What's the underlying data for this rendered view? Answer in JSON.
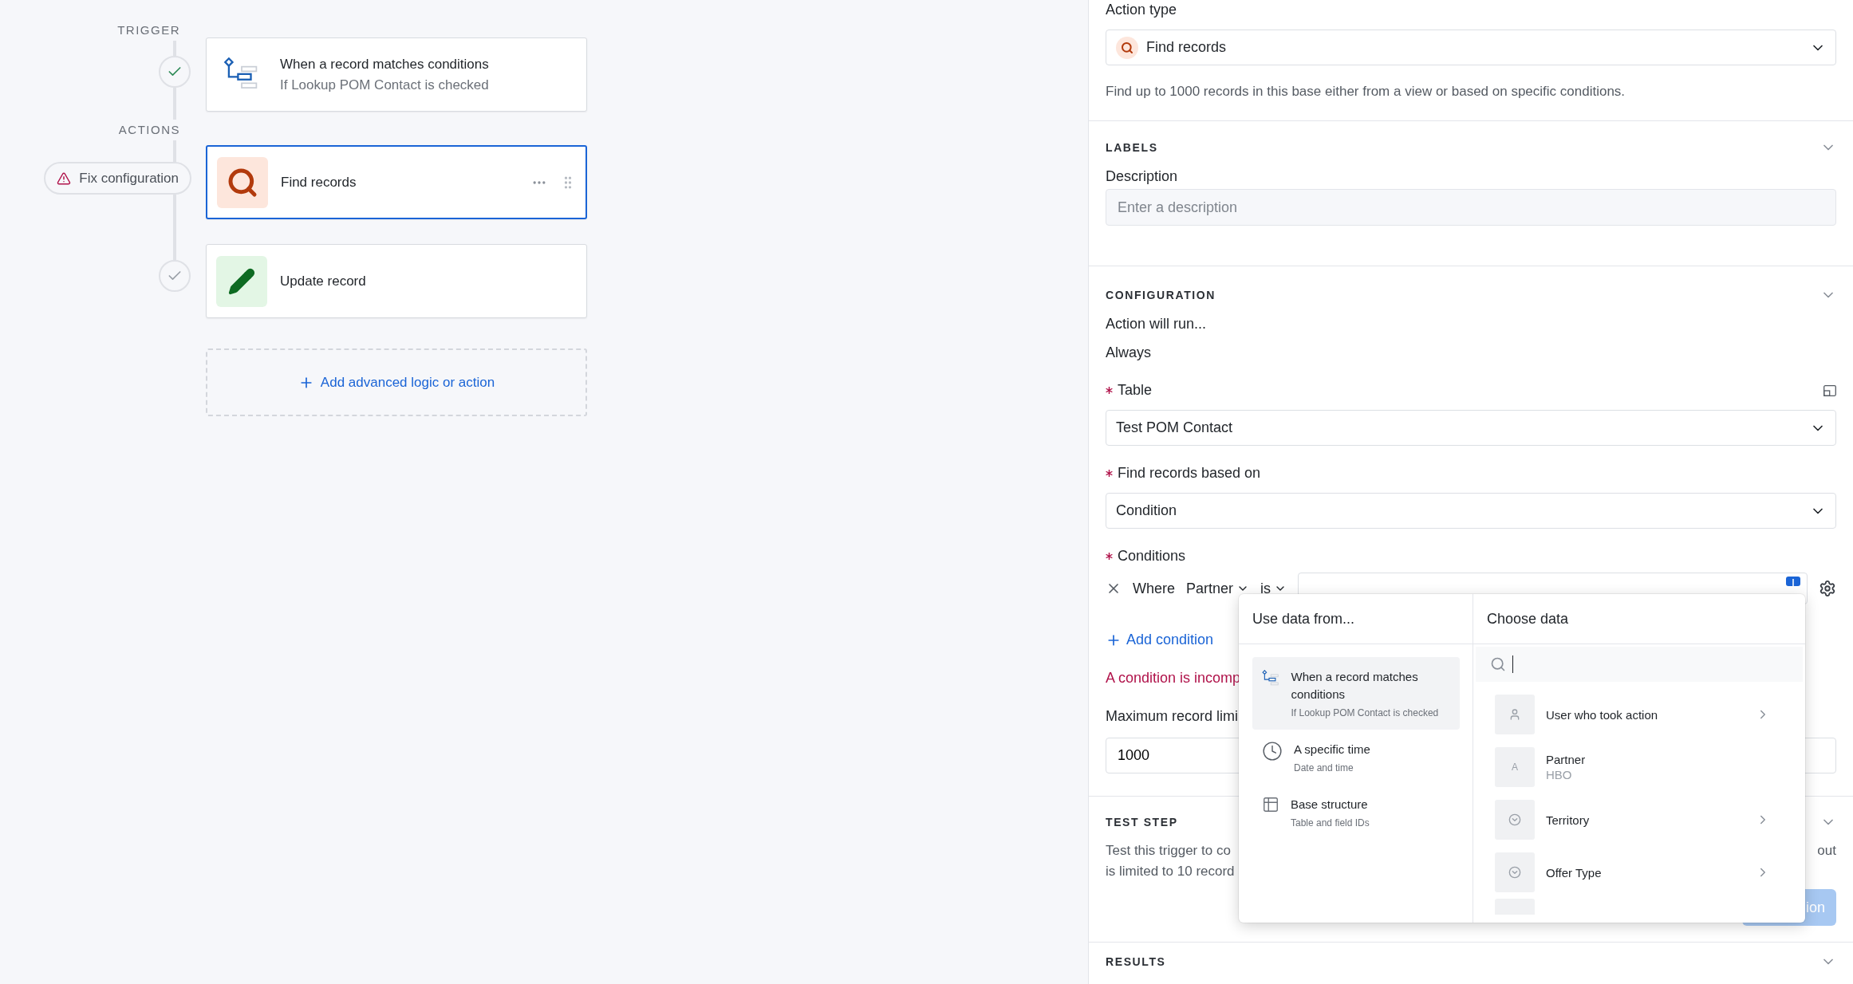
{
  "workflow": {
    "trigger_label": "TRIGGER",
    "actions_label": "ACTIONS",
    "trigger": {
      "title": "When a record matches conditions",
      "subtitle": "If Lookup POM Contact is checked",
      "tested": true
    },
    "actions": [
      {
        "kind": "find",
        "title": "Find records",
        "selected": true,
        "warning": "Fix configuration"
      },
      {
        "kind": "update",
        "title": "Update record",
        "selected": false,
        "tested": false
      }
    ],
    "add_button": "Add advanced logic or action"
  },
  "action_type": {
    "label": "Action type",
    "value": "Find records",
    "description": "Find up to 1000 records in this base either from a view or based on specific conditions."
  },
  "labels_section": {
    "title": "LABELS",
    "expanded": true,
    "description_field": {
      "label": "Description",
      "placeholder": "Enter a description"
    }
  },
  "configuration": {
    "title": "CONFIGURATION",
    "expanded": true,
    "run_label": "Action will run...",
    "run_value": "Always",
    "table": {
      "label": "Table",
      "required": true,
      "value": "Test POM Contact"
    },
    "based_on": {
      "label": "Find records based on",
      "required": true,
      "value": "Condition"
    },
    "conditions": {
      "label": "Conditions",
      "required": true,
      "where": "Where",
      "field": "Partner",
      "operator": "is",
      "add_label": "Add condition",
      "error": "A condition is incomp"
    },
    "limit": {
      "label": "Maximum record limi",
      "value": "1000"
    }
  },
  "test_step": {
    "title": "TEST STEP",
    "expanded": true,
    "lines": [
      "Test this trigger to co",
      "is limited to 10 record"
    ],
    "tail": "out",
    "button": "ion"
  },
  "results": {
    "title": "RESULTS",
    "expanded": true
  },
  "data_picker": {
    "source_header": "Use data from...",
    "choose_header": "Choose data",
    "sources": [
      {
        "kind": "trigger",
        "title": "When a record matches conditions",
        "subtitle": "If Lookup POM Contact is checked",
        "selected": true
      },
      {
        "kind": "time",
        "title": "A specific time",
        "subtitle": "Date and time",
        "selected": false
      },
      {
        "kind": "table",
        "title": "Base structure",
        "subtitle": "Table and field IDs",
        "selected": false
      }
    ],
    "fields": [
      {
        "kind": "user",
        "name": "User who took action",
        "has_children": true
      },
      {
        "kind": "text",
        "glyph": "A",
        "name": "Partner",
        "value": "HBO",
        "has_children": false
      },
      {
        "kind": "select",
        "name": "Territory",
        "has_children": true
      },
      {
        "kind": "select",
        "name": "Offer Type",
        "has_children": true
      }
    ]
  }
}
